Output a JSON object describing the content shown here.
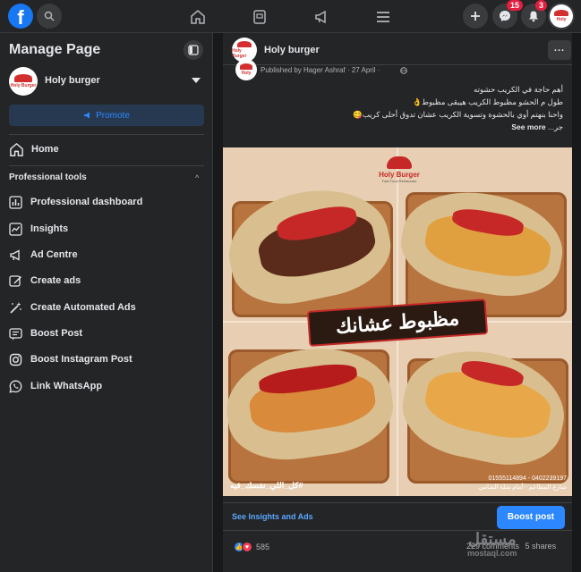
{
  "topbar": {
    "logo": "f",
    "badges": {
      "messenger": "15",
      "notifications": "3"
    }
  },
  "sidebar": {
    "title": "Manage Page",
    "page_name": "Holy burger",
    "promote_label": "Promote",
    "home_label": "Home",
    "section_title": "Professional tools",
    "tools": [
      {
        "label": "Professional dashboard",
        "icon": "dashboard-icon"
      },
      {
        "label": "Insights",
        "icon": "insights-icon"
      },
      {
        "label": "Ad Centre",
        "icon": "megaphone-icon"
      },
      {
        "label": "Create ads",
        "icon": "pencil-icon"
      },
      {
        "label": "Create Automated Ads",
        "icon": "wand-icon"
      },
      {
        "label": "Boost Post",
        "icon": "boost-post-icon"
      },
      {
        "label": "Boost Instagram Post",
        "icon": "instagram-icon"
      },
      {
        "label": "Link WhatsApp",
        "icon": "whatsapp-icon"
      }
    ]
  },
  "post": {
    "page_name": "Holy burger",
    "more_label": "...",
    "meta": "Published by Hager Ashraf · 27 April ·",
    "lines": [
      "أهم حاجة في الكريب حشوته",
      "طول م الحشو مظبوط الكريب هيبقى مظبوط👌",
      "واحنا بنهتم أوي بالحشوة وتسوية الكريب عشان تدوق أحلى كريب😋"
    ],
    "last_line_prefix": "جر... ",
    "see_more": "See more",
    "image": {
      "brand_name": "Holy Burger",
      "brand_sub": "Fast Food Restaurant",
      "banner_text": "مظبوط عشانك",
      "caption_left": "#كل_اللي_نفسك_فيه",
      "phones": "0402239197 - 01555114894",
      "address": "شارع المطاعم - أمام شلة الشامي"
    },
    "insights_link": "See Insights and Ads",
    "boost_label": "Boost post",
    "reaction_count": "585",
    "comments": "229 comments",
    "shares": "5 shares"
  },
  "watermark": {
    "arabic": "مستقل",
    "latin": "mostaql.com"
  },
  "colors": {
    "accent": "#2d88ff",
    "badge": "#e41e3f",
    "background": "#18191a",
    "surface": "#242526"
  }
}
